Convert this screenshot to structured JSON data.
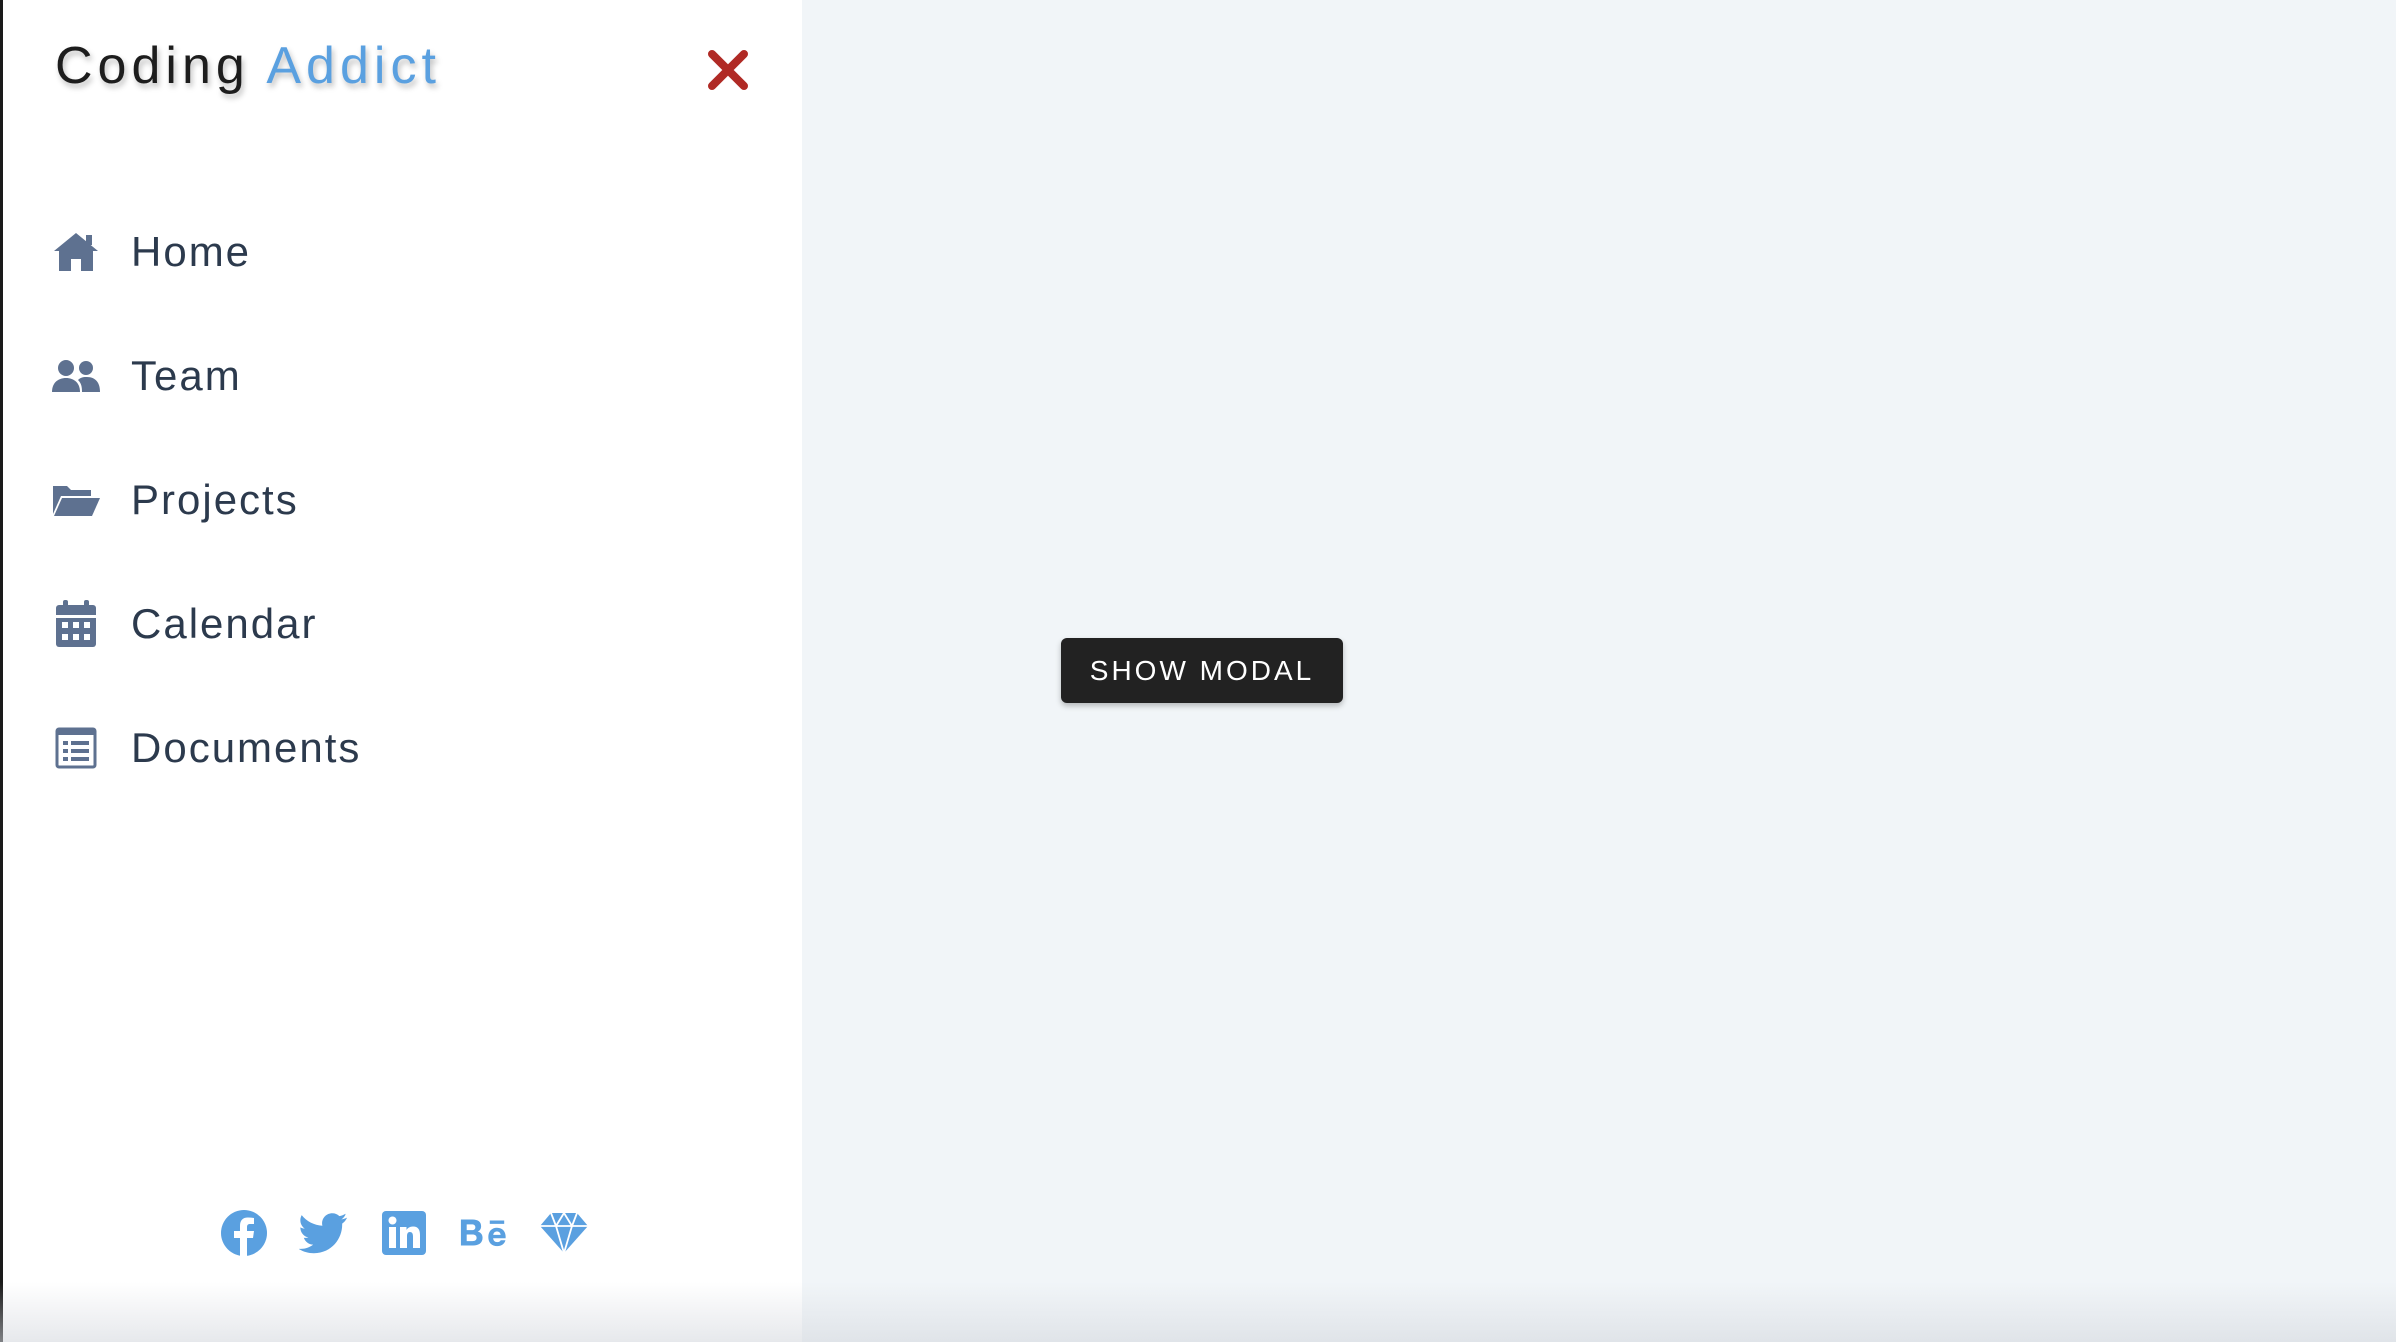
{
  "sidebar": {
    "logo": {
      "text": "Coding",
      "accent": "Addict"
    },
    "nav": [
      {
        "label": "Home",
        "icon": "home-icon"
      },
      {
        "label": "Team",
        "icon": "users-icon"
      },
      {
        "label": "Projects",
        "icon": "folder-open-icon"
      },
      {
        "label": "Calendar",
        "icon": "calendar-icon"
      },
      {
        "label": "Documents",
        "icon": "document-icon"
      }
    ],
    "social": [
      "facebook-icon",
      "twitter-icon",
      "linkedin-icon",
      "behance-icon",
      "sketch-icon"
    ]
  },
  "main": {
    "button_label": "SHOW MODAL"
  },
  "colors": {
    "accent": "#5aa0e0",
    "close": "#b02a25",
    "nav_icon": "#5e7190",
    "nav_text": "#2c3a4d",
    "background": "#f1f5f8",
    "button": "#222222"
  }
}
